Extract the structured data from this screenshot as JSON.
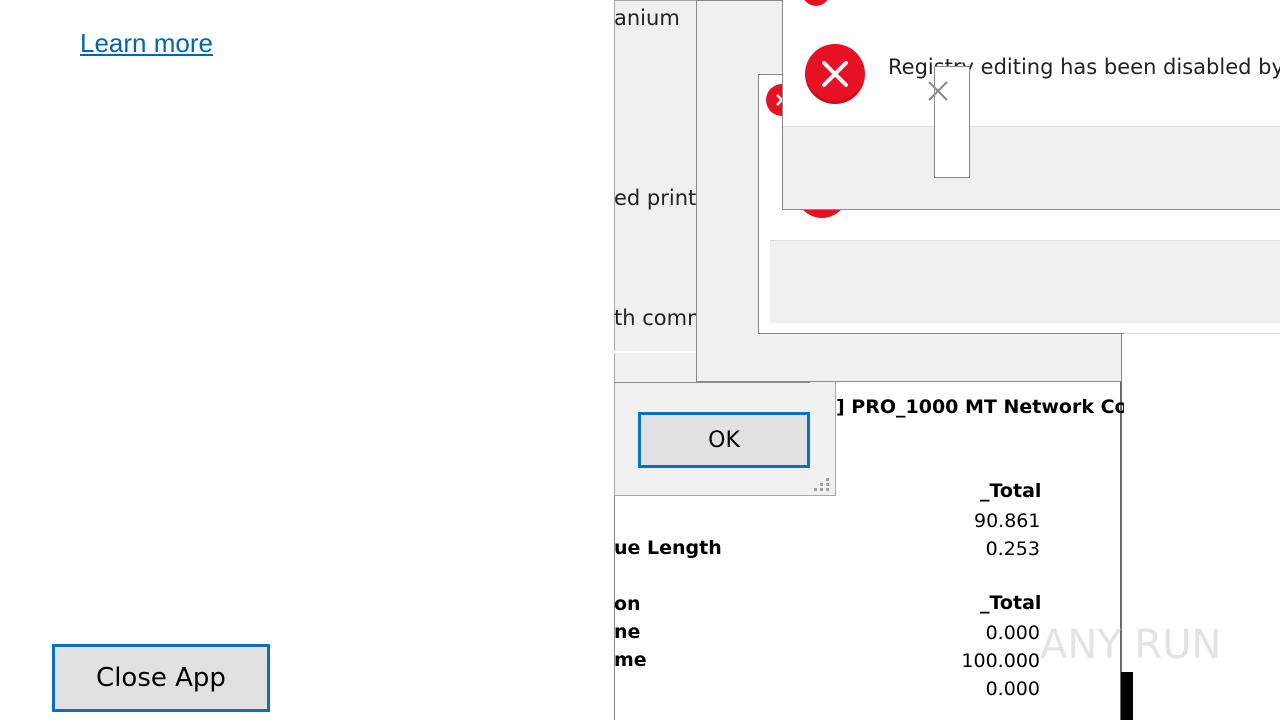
{
  "left_pane": {
    "learn_more": "Learn more",
    "close_app": "Close App"
  },
  "background_dialog": {
    "line1": "anium",
    "line2": "ed print",
    "line3": "th comm",
    "ok": "OK"
  },
  "perf_window": {
    "adapter_title": "] PRO_1000 MT Network Co",
    "group1_header": "_Total",
    "group1_values": [
      "90.861",
      "0.253"
    ],
    "group1_labels": [
      "",
      "ue Length"
    ],
    "group2_header_label": "on",
    "group2_header": "_Total",
    "group2_labels": [
      "ne",
      "me",
      ""
    ],
    "group2_values": [
      "0.000",
      "100.000",
      "0.000"
    ]
  },
  "error_dialog": {
    "message": "Registry editing has been disabled by",
    "icon": "error-x-icon",
    "color": "#e81123"
  },
  "watermark": "ANY RUN"
}
